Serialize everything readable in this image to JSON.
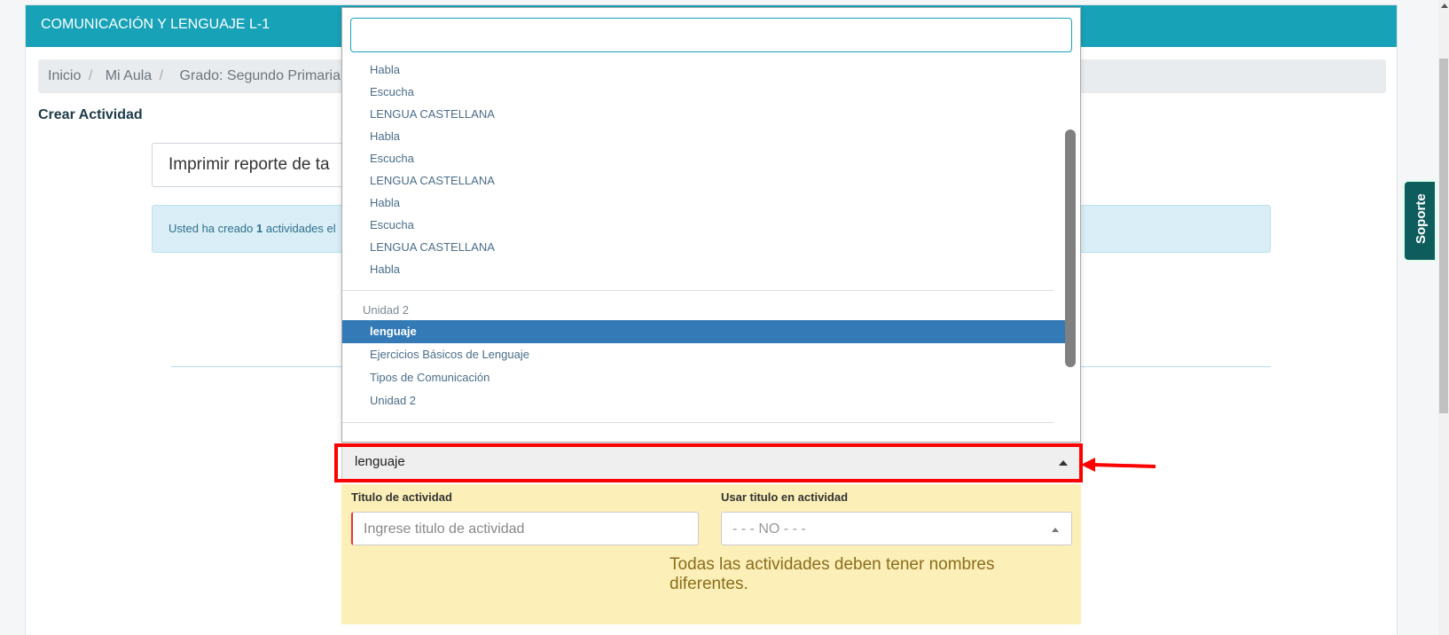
{
  "header": {
    "title": "COMUNICACIÓN Y LENGUAJE L-1"
  },
  "breadcrumb": {
    "items": [
      "Inicio",
      "Mi Aula",
      "Grado: Segundo Primaria - S"
    ],
    "separators": [
      "/",
      "/"
    ]
  },
  "crear_actividad": "Crear Actividad",
  "imprimir_label": "Imprimir reporte de ta",
  "alert": {
    "prefix": "Usted ha creado ",
    "count": "1",
    "suffix": " actividades el"
  },
  "dropdown": {
    "search_value": "",
    "items_top": [
      "Habla",
      "Escucha",
      "LENGUA CASTELLANA",
      "Habla",
      "Escucha",
      "LENGUA CASTELLANA",
      "Habla",
      "Escucha",
      "LENGUA CASTELLANA",
      "Habla"
    ],
    "group_label": "Unidad 2",
    "items_group": [
      "lenguaje",
      "Ejercicios Básicos de Lenguaje",
      "Tipos de Comunicación",
      "Unidad 2"
    ],
    "selected": "lenguaje"
  },
  "select": {
    "value": "lenguaje"
  },
  "form": {
    "titulo_label": "Titulo de actividad",
    "titulo_placeholder": "Ingrese titulo de actividad",
    "usar_titulo_label": "Usar titulo en actividad",
    "usar_titulo_value": "- - - NO - - -",
    "warning": "Todas las actividades deben tener nombres diferentes."
  },
  "soporte": "Soporte",
  "colors": {
    "header": "#17a2b8",
    "selected": "#337ab7",
    "highlight": "#ff0000",
    "form_bg": "#fcefb7"
  }
}
